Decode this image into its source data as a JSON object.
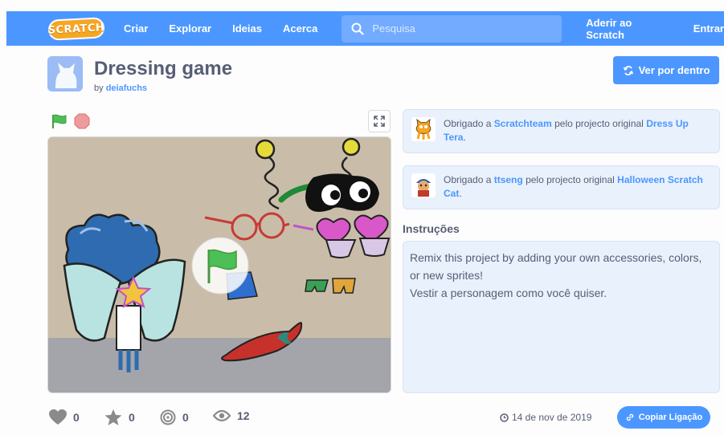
{
  "nav": {
    "logo": "SCRATCH",
    "create": "Criar",
    "explore": "Explorar",
    "ideas": "Ideias",
    "about": "Acerca",
    "search_placeholder": "Pesquisa",
    "join": "Aderir ao Scratch",
    "signin": "Entrar"
  },
  "project": {
    "title": "Dressing game",
    "by": "by",
    "author": "deiafuchs",
    "see_inside": "Ver por dentro"
  },
  "credits": [
    {
      "prefix": "Obrigado a",
      "user": "Scratchteam",
      "middle": "pelo projecto original",
      "project": "Dress Up Tera",
      "suffix": "."
    },
    {
      "prefix": "Obrigado a",
      "user": "ttseng",
      "middle": "pelo projecto original",
      "project": "Halloween Scratch Cat",
      "suffix": "."
    }
  ],
  "instructions": {
    "heading": "Instruções",
    "line1": "Remix this project by adding your own accessories, colors, or new sprites!",
    "line2": "Vestir a personagem como você quiser."
  },
  "stats": {
    "loves": "0",
    "favorites": "0",
    "remixes": "0",
    "views": "12"
  },
  "date": "14 de nov de 2019",
  "copy_link": "Copiar Ligação",
  "colors": {
    "brand_blue": "#4c97ff",
    "text": "#575e75",
    "panel": "#e9f1fc",
    "logo_orange": "#f7a623"
  }
}
